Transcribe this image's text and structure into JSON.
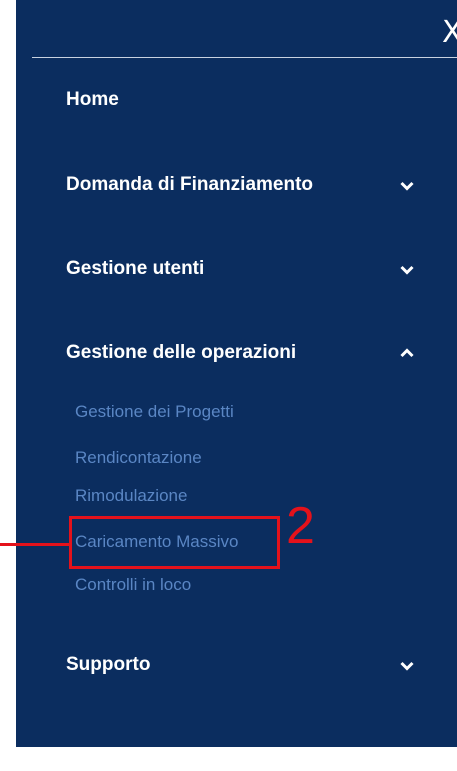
{
  "header": {
    "close_label": "X"
  },
  "menu": {
    "items": [
      {
        "label": "Home"
      },
      {
        "label": "Domanda di Finanziamento"
      },
      {
        "label": "Gestione utenti"
      },
      {
        "label": "Gestione delle operazioni"
      },
      {
        "label": "Supporto"
      }
    ],
    "sub_items": [
      {
        "label": "Gestione dei Progetti"
      },
      {
        "label": "Rendicontazione"
      },
      {
        "label": "Rimodulazione"
      },
      {
        "label": "Caricamento Massivo"
      },
      {
        "label": "Controlli in loco"
      }
    ]
  },
  "annotation": {
    "step_number": "2"
  },
  "colors": {
    "panel_background": "#0b2d5f",
    "sub_item_text": "#5a86c4",
    "annotation_red": "#e4121b"
  }
}
